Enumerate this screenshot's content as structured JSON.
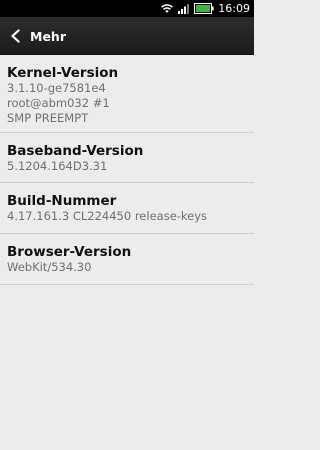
{
  "status_bar": {
    "time": "16:09",
    "icons": [
      "wifi-icon",
      "signal-icon",
      "battery-icon"
    ],
    "battery_color": "#3fb53f"
  },
  "action_bar": {
    "back_icon": "chevron-left-icon",
    "title": "Mehr"
  },
  "items": [
    {
      "label": "Kernel-Version",
      "value": "3.1.10-ge7581e4\nroot@abm032 #1\nSMP PREEMPT"
    },
    {
      "label": "Baseband-Version",
      "value": "5.1204.164D3.31"
    },
    {
      "label": "Build-Nummer",
      "value": "4.17.161.3 CL224450 release-keys"
    },
    {
      "label": "Browser-Version",
      "value": "WebKit/534.30"
    }
  ]
}
